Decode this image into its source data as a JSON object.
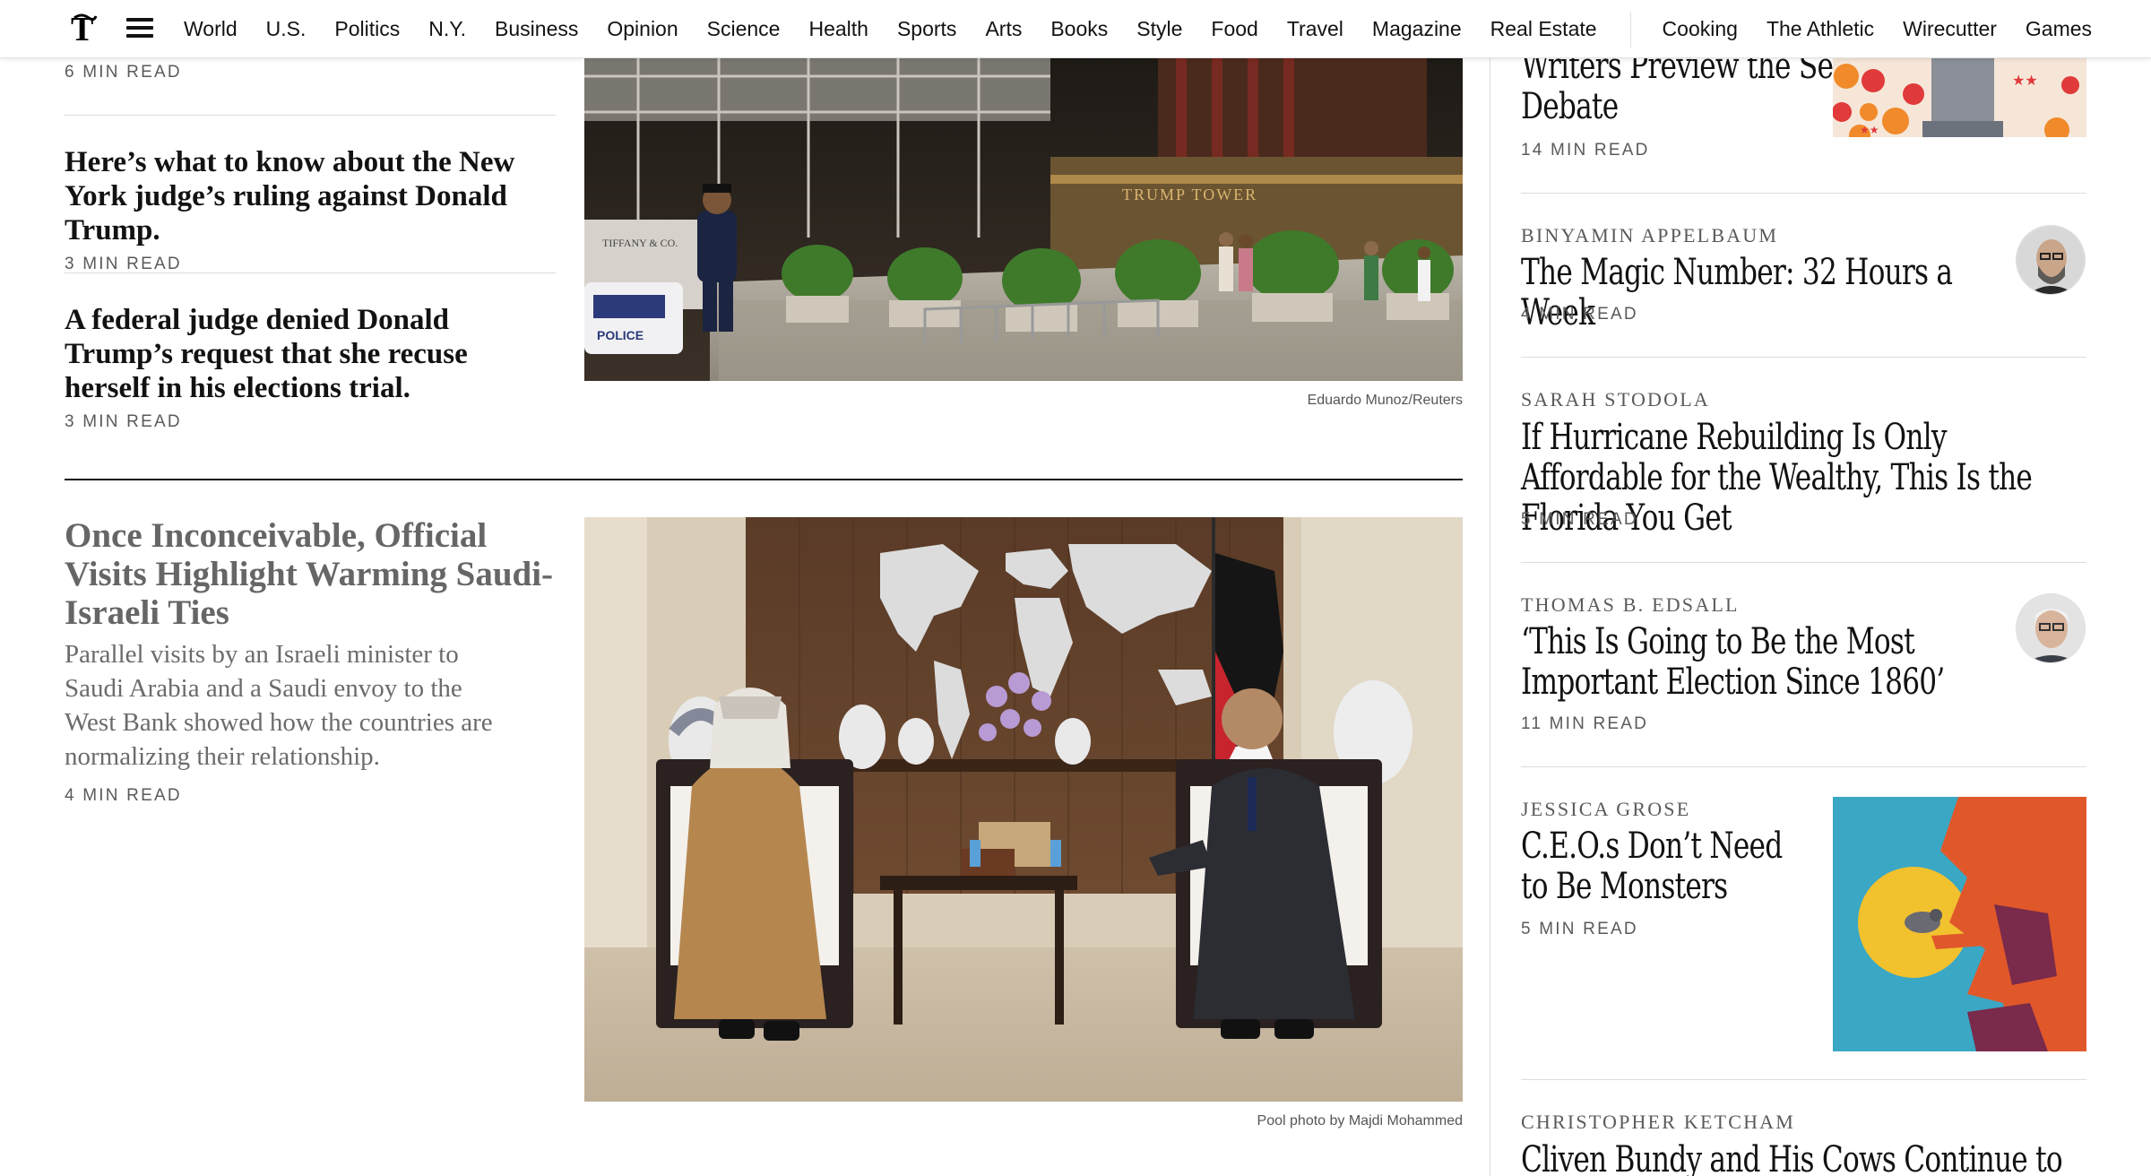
{
  "nav": {
    "items": [
      "World",
      "U.S.",
      "Politics",
      "N.Y.",
      "Business",
      "Opinion",
      "Science",
      "Health",
      "Sports",
      "Arts",
      "Books",
      "Style",
      "Food",
      "Travel",
      "Magazine",
      "Real Estate"
    ],
    "secondary": [
      "Cooking",
      "The Athletic",
      "Wirecutter",
      "Games"
    ],
    "logo": "𝕿"
  },
  "left": {
    "top_minread": "6 MIN READ",
    "story1": {
      "headline": "Here’s what to know about the New York judge’s ruling against Donald Trump.",
      "minread": "3 MIN READ"
    },
    "story2": {
      "headline": "A federal judge denied Donald Trump’s request that she recuse herself in his elections trial.",
      "minread": "3 MIN READ"
    },
    "story3": {
      "headline": "Once Inconceivable, Official Visits Highlight Warming Saudi-Israeli Ties",
      "summary": "Parallel visits by an Israeli minister to Saudi Arabia and a Saudi envoy to the West Bank showed how the countries are normalizing their relationship.",
      "minread": "4 MIN READ"
    }
  },
  "photos": {
    "trump_tower_credit": "Eduardo Munoz/Reuters",
    "trump_tower_sign": "TRUMP TOWER",
    "police_text": "POLICE",
    "tiffany_text": "TIFFANY & CO.",
    "saudi_credit": "Pool photo by Majdi Mohammed"
  },
  "opinion": [
    {
      "author": "",
      "headline": "Writers Preview the Second G.O.P. Debate",
      "minread": "14 MIN READ"
    },
    {
      "author": "BINYAMIN APPELBAUM",
      "headline": "The Magic Number: 32 Hours a Week",
      "minread": "4 MIN READ"
    },
    {
      "author": "SARAH STODOLA",
      "headline": "If Hurricane Rebuilding Is Only Affordable for the Wealthy, This Is the Florida You Get",
      "minread": "5 MIN READ"
    },
    {
      "author": "THOMAS B. EDSALL",
      "headline": "‘This Is Going to Be the Most Important Election Since 1860’",
      "minread": "11 MIN READ"
    },
    {
      "author": "JESSICA GROSE",
      "headline": "C.E.O.s Don’t Need to Be Monsters",
      "minread": "5 MIN READ"
    },
    {
      "author": "CHRISTOPHER KETCHAM",
      "headline": "Cliven Bundy and His Cows Continue to Flout",
      "minread": ""
    }
  ]
}
